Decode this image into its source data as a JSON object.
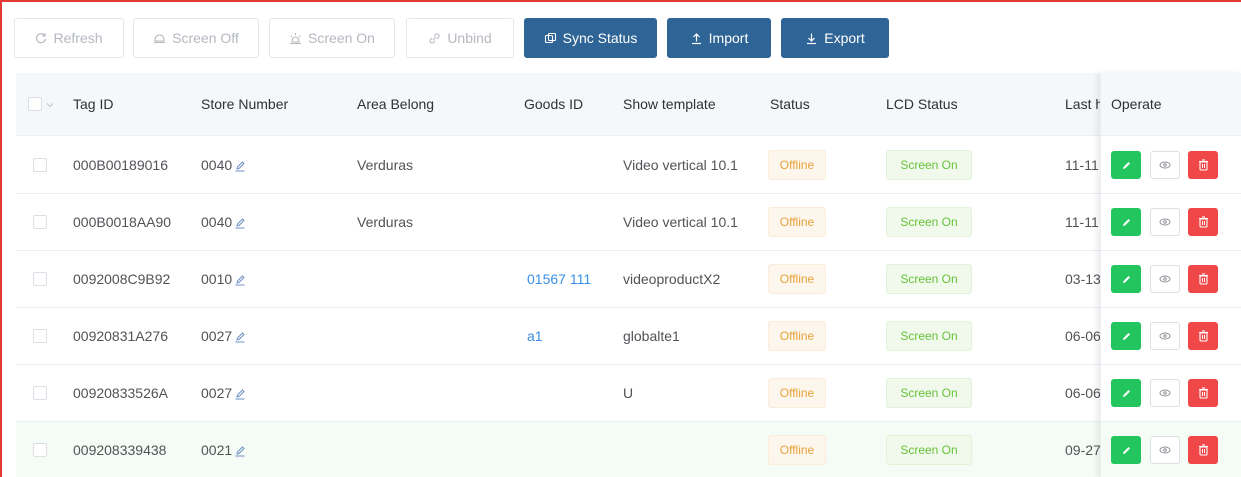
{
  "toolbar": {
    "refresh": "Refresh",
    "screen_off": "Screen Off",
    "screen_on": "Screen On",
    "unbind": "Unbind",
    "sync_status": "Sync Status",
    "import": "Import",
    "export": "Export"
  },
  "columns": {
    "tag_id": "Tag ID",
    "store_number": "Store Number",
    "area_belong": "Area Belong",
    "goods_id": "Goods ID",
    "show_template": "Show template",
    "status": "Status",
    "lcd_status": "LCD Status",
    "last": "Last h",
    "operate": "Operate"
  },
  "rows": [
    {
      "tag_id": "000B00189016",
      "store": "0040",
      "area": "Verduras",
      "goods": "",
      "template": "Video vertical 10.1",
      "status": "Offline",
      "lcd": "Screen On",
      "last": "11-11"
    },
    {
      "tag_id": "000B0018AA90",
      "store": "0040",
      "area": "Verduras",
      "goods": "",
      "template": "Video vertical 10.1",
      "status": "Offline",
      "lcd": "Screen On",
      "last": "11-11"
    },
    {
      "tag_id": "0092008C9B92",
      "store": "0010",
      "area": "",
      "goods": "01567 111",
      "template": "videoproductX2",
      "status": "Offline",
      "lcd": "Screen On",
      "last": "03-13"
    },
    {
      "tag_id": "00920831A276",
      "store": "0027",
      "area": "",
      "goods": "a1",
      "template": "globalte1",
      "status": "Offline",
      "lcd": "Screen On",
      "last": "06-06"
    },
    {
      "tag_id": "00920833526A",
      "store": "0027",
      "area": "",
      "goods": "",
      "template": "U",
      "status": "Offline",
      "lcd": "Screen On",
      "last": "06-06"
    },
    {
      "tag_id": "009208339438",
      "store": "0021",
      "area": "",
      "goods": "",
      "template": "",
      "status": "Offline",
      "lcd": "Screen On",
      "last": "09-27"
    }
  ],
  "colors": {
    "primary": "#2f6496",
    "offline": "#e6a23c",
    "screen_on": "#67c23a",
    "edit": "#22c55e",
    "delete": "#f04848",
    "link": "#3a8ee6"
  },
  "icons": [
    "refresh-icon",
    "screen-off-icon",
    "screen-on-icon",
    "unbind-icon",
    "sync-icon",
    "import-icon",
    "export-icon",
    "pencil-icon",
    "eye-icon",
    "trash-icon"
  ]
}
